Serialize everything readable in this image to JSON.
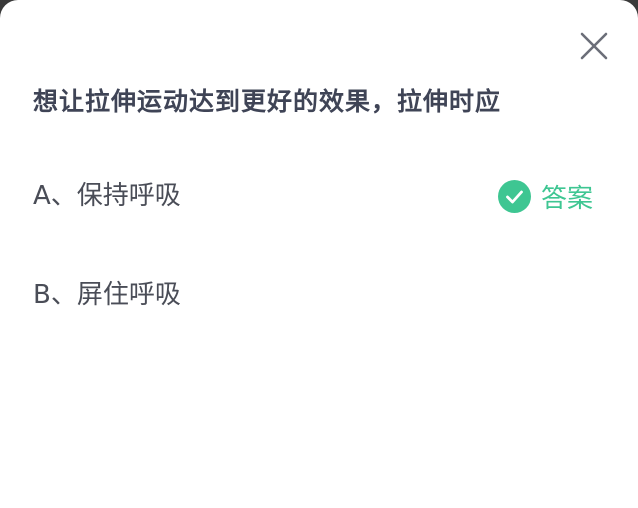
{
  "question": {
    "text": "想让拉伸运动达到更好的效果，拉伸时应"
  },
  "options": [
    {
      "text": "A、保持呼吸",
      "is_answer": true
    },
    {
      "text": "B、屏住呼吸",
      "is_answer": false
    }
  ],
  "answer_badge": {
    "label": "答案",
    "icon": "check-circle-icon",
    "color": "#3ec692"
  },
  "close": {
    "icon": "close-icon"
  },
  "colors": {
    "question": "#3f4456",
    "option": "#4a4d57",
    "accent": "#3ec692",
    "background": "#ffffff"
  }
}
